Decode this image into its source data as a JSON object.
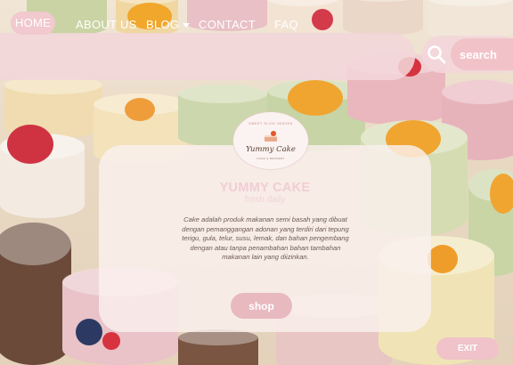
{
  "nav": {
    "items": [
      {
        "label": "HOME"
      },
      {
        "label": "ABOUT US"
      },
      {
        "label": "BLOG"
      },
      {
        "label": "CONTACT"
      },
      {
        "label": "FAQ"
      }
    ]
  },
  "search": {
    "placeholder": "search",
    "icon": "search-icon"
  },
  "logo": {
    "arc_text": "SWEET SLICE HEAVEN",
    "name": "Yummy Cake",
    "sub": "CAKE & DESSERT"
  },
  "hero": {
    "title": "YUMMY CAKE",
    "subtitle": "fresh daily",
    "description": "Cake adalah produk makanan semi basah yang dibuat dengan pemanggangan adonan yang terdiri dari tepung terigu, gula, telur, susu, lemak, dan bahan pengembang dengan atau tanpa penambahan bahan tambahan makanan lain yang diizinkan."
  },
  "buttons": {
    "shop": "shop",
    "exit": "EXIT"
  },
  "colors": {
    "nav_bg": "#f3d6da",
    "accent_pink": "#e8b9bf",
    "title_pink": "#f2cdd3",
    "text_brown": "#6d5a55"
  }
}
